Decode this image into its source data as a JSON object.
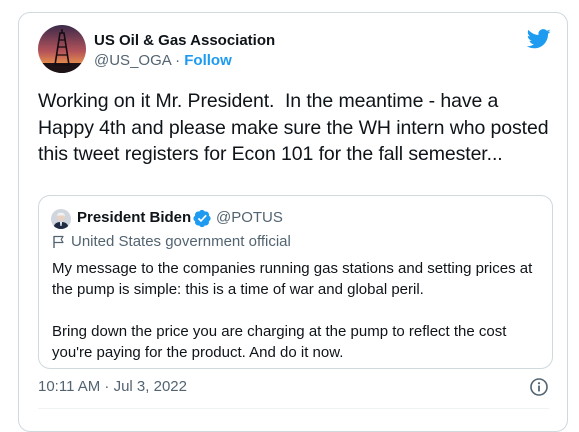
{
  "tweet": {
    "author": {
      "name": "US Oil & Gas Association",
      "handle": "@US_OGA",
      "separator": " · ",
      "follow_label": "Follow"
    },
    "text": "Working on it Mr. President.  In the meantime - have a Happy 4th and please make sure the WH intern who posted this tweet registers for Econ 101 for the fall semester...",
    "timestamp": "10:11 AM · Jul 3, 2022"
  },
  "quoted_tweet": {
    "author": {
      "name": "President Biden",
      "handle": "@POTUS",
      "label": "United States government official"
    },
    "paragraphs": [
      "My message to the companies running gas stations and setting prices at the pump is simple: this is a time of war and global peril.",
      "Bring down the price you are charging at the pump to reflect the cost you're paying for the product. And do it now."
    ]
  },
  "colors": {
    "accent": "#1d9bf0",
    "text_primary": "#0f1419",
    "text_secondary": "#536471",
    "border": "#cfd9de"
  },
  "icons": {
    "logo": "twitter-bird-icon",
    "verified": "verified-badge-icon",
    "label": "flag-icon",
    "info": "info-icon"
  }
}
